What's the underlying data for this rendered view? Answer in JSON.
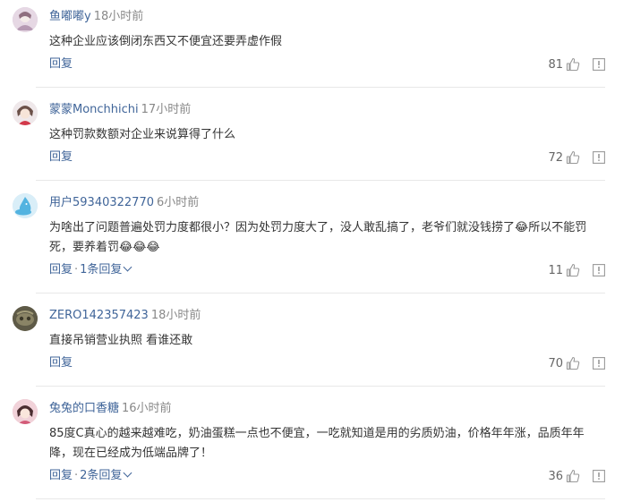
{
  "colors": {
    "username": "#406599",
    "meta": "#888888",
    "text": "#333333",
    "divider": "#e8e8e8"
  },
  "icons": {
    "like": "thumbs-up-icon",
    "report": "report-icon",
    "expand": "chevron-down-icon"
  },
  "comments": [
    {
      "username": "鱼嘟嘟y",
      "time": "18小时前",
      "text": "这种企业应该倒闭东西又不便宜还要弄虚作假",
      "reply_label": "回复",
      "replies_label": "",
      "likes": "81",
      "avatar_color": "#d6c5d8"
    },
    {
      "username": "蒙蒙Monchhichi",
      "time": "17小时前",
      "text": "这种罚款数额对企业来说算得了什么",
      "reply_label": "回复",
      "replies_label": "",
      "likes": "72",
      "avatar_color": "#e9dfe2"
    },
    {
      "username": "用户59340322770",
      "time": "6小时前",
      "text": "为啥出了问题普遍处罚力度都很小？因为处罚力度大了，没人敢乱搞了，老爷们就没钱捞了😂所以不能罚死，要养着罚😂😂😂",
      "reply_label": "回复",
      "replies_label": "1条回复",
      "likes": "11",
      "avatar_color": "#cfe6f3"
    },
    {
      "username": "ZERO142357423",
      "time": "18小时前",
      "text": "直接吊销营业执照 看谁还敢",
      "reply_label": "回复",
      "replies_label": "",
      "likes": "70",
      "avatar_color": "#6e6a55"
    },
    {
      "username": "兔兔的口香糖",
      "time": "16小时前",
      "text": "85度C真心的越来越难吃，奶油蛋糕一点也不便宜，一吃就知道是用的劣质奶油，价格年年涨，品质年年降，现在已经成为低端品牌了！",
      "reply_label": "回复",
      "replies_label": "2条回复",
      "likes": "36",
      "avatar_color": "#e8b9c4"
    }
  ]
}
